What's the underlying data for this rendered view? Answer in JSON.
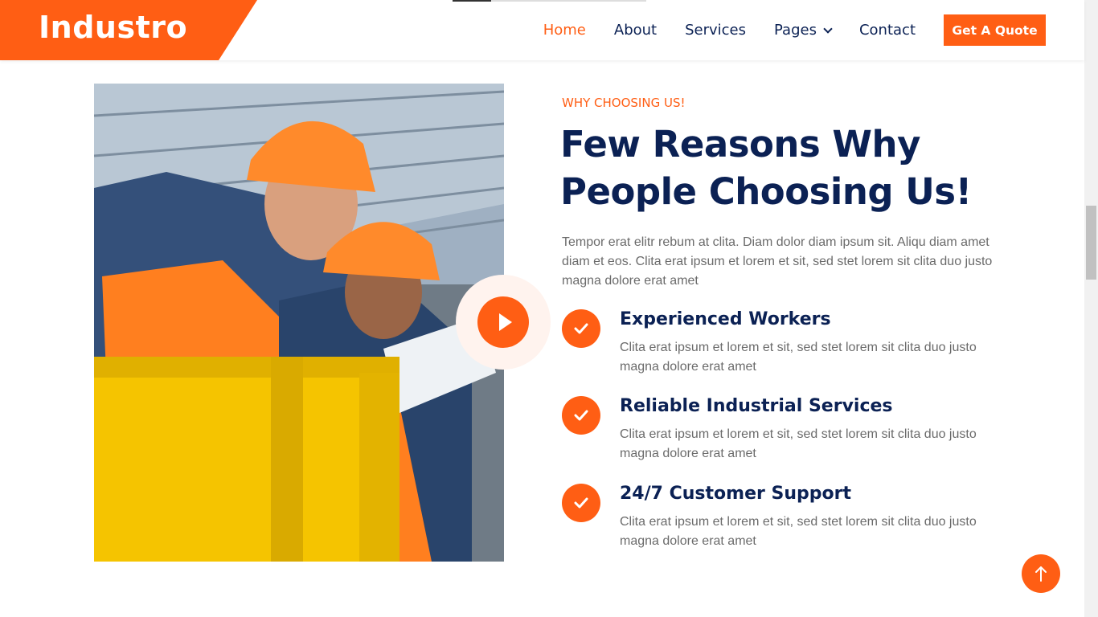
{
  "navbar": {
    "brand": "Industro",
    "links": [
      {
        "label": "Home",
        "active": true
      },
      {
        "label": "About"
      },
      {
        "label": "Services"
      },
      {
        "label": "Pages",
        "has_dropdown": true
      },
      {
        "label": "Contact"
      }
    ],
    "cta_label": "Get A Quote"
  },
  "hero_image": {
    "icon": "image-workers-hardhats"
  },
  "play_button": {
    "icon": "play-icon"
  },
  "section": {
    "eyebrow": "WHY CHOOSING US!",
    "headline_line1": "Few Reasons Why",
    "headline_line2": "People Choosing Us!",
    "lead": "Tempor erat elitr rebum at clita. Diam dolor diam ipsum sit. Aliqu diam amet diam et eos. Clita erat ipsum et lorem et sit, sed stet lorem sit clita duo justo magna dolore erat amet",
    "features": [
      {
        "title": "Experienced Workers",
        "description": "Clita erat ipsum et lorem et sit, sed stet lorem sit clita duo justo magna dolore erat amet",
        "icon": "check-icon"
      },
      {
        "title": "Reliable Industrial Services",
        "description": "Clita erat ipsum et lorem et sit, sed stet lorem sit clita duo justo magna dolore erat amet",
        "icon": "check-icon"
      },
      {
        "title": "24/7 Customer Support",
        "description": "Clita erat ipsum et lorem et sit, sed stet lorem sit clita duo justo magna dolore erat amet",
        "icon": "check-icon"
      }
    ]
  },
  "back_to_top": {
    "icon": "arrow-up-icon"
  },
  "colors": {
    "accent": "#FF5E14",
    "heading": "#0B2154",
    "body_text": "#6b6b6b"
  }
}
